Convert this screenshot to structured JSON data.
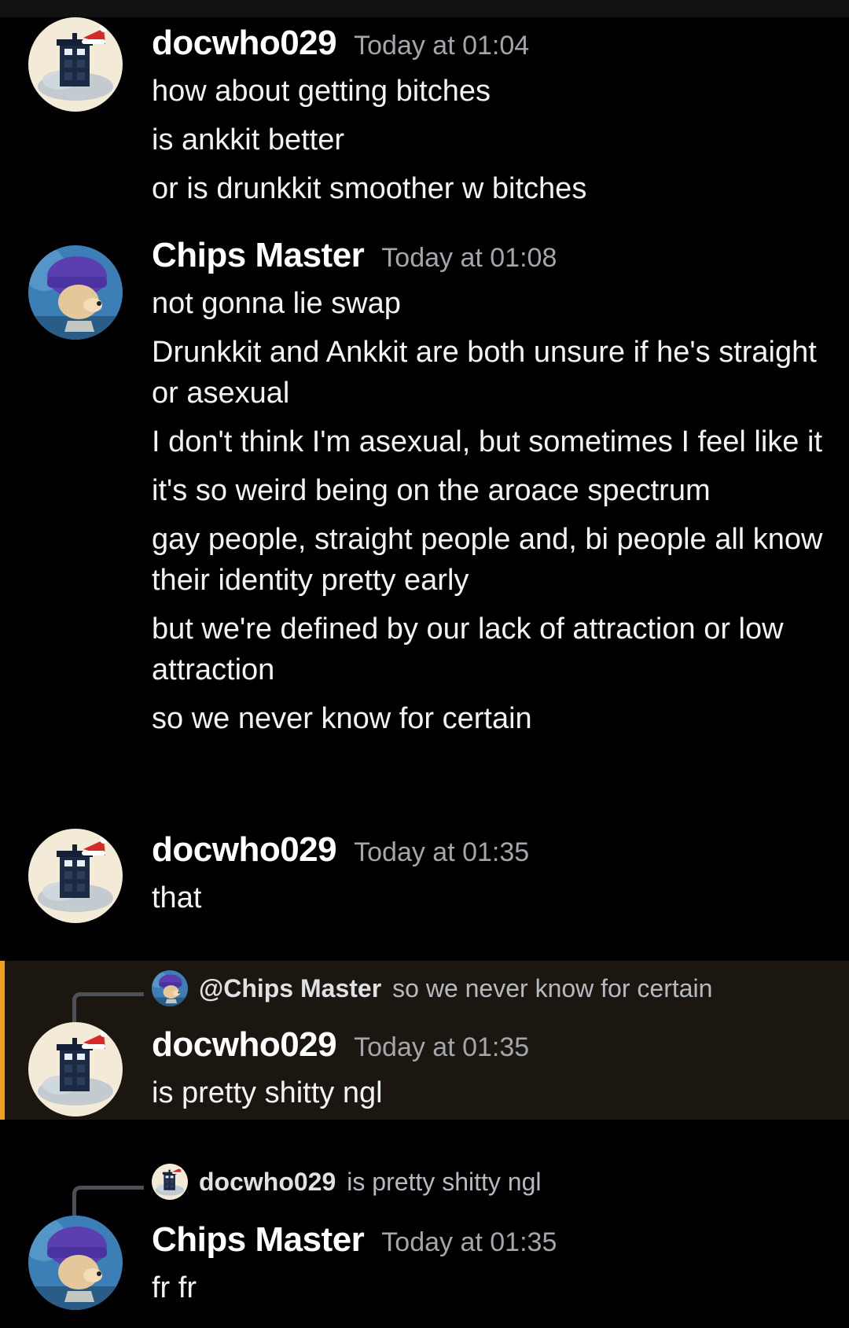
{
  "messages": [
    {
      "author": "docwho029",
      "timestamp": "Today at 01:04",
      "avatar": "tardis-avatar",
      "lines": [
        "how about getting bitches",
        "is ankkit better",
        "or is drunkkit smoother w bitches"
      ]
    },
    {
      "author": "Chips Master",
      "timestamp": "Today at 01:08",
      "avatar": "dog-beanie-avatar",
      "lines": [
        "not gonna lie swap",
        "Drunkkit and Ankkit are both unsure if he's straight or asexual",
        "I don't think I'm asexual, but sometimes I feel like it",
        "it's so weird being on the aroace spectrum",
        "gay people, straight people and, bi people all know their identity pretty early",
        "but we're defined by our lack of attraction or low attraction",
        "so we never know for certain"
      ]
    },
    {
      "author": "docwho029",
      "timestamp": "Today at 01:35",
      "avatar": "tardis-avatar",
      "lines": [
        "that"
      ]
    },
    {
      "author": "docwho029",
      "timestamp": "Today at 01:35",
      "avatar": "tardis-avatar",
      "highlighted": true,
      "reply": {
        "name": "@Chips Master",
        "text": "so we never know for certain",
        "avatar": "dog-beanie-avatar"
      },
      "lines": [
        "is pretty shitty ngl"
      ]
    },
    {
      "author": "Chips Master",
      "timestamp": "Today at 01:35",
      "avatar": "dog-beanie-avatar",
      "reply": {
        "name": "docwho029",
        "text": "is pretty shitty ngl",
        "avatar": "tardis-avatar"
      },
      "lines": [
        "fr fr"
      ]
    }
  ],
  "colors": {
    "background": "#000000",
    "mention_highlight": "#1c1610",
    "mention_bar": "#f0a020",
    "timestamp": "#a3a6aa"
  }
}
